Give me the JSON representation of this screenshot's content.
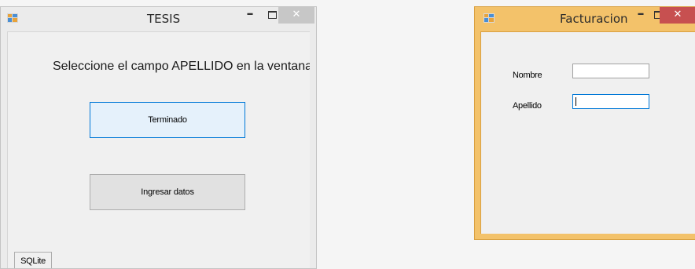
{
  "tesis_window": {
    "title": "TESIS",
    "icon": "app-form-icon",
    "minimize_glyph": "–",
    "close_glyph": "✕",
    "instruction": "Seleccione el campo APELLIDO en la ventana d",
    "buttons": {
      "terminado_label": "Terminado",
      "ingresar_label": "Ingresar datos"
    },
    "tab_label": "SQLite"
  },
  "facturacion_window": {
    "title": "Facturacion",
    "icon": "app-form-icon",
    "minimize_glyph": "–",
    "close_glyph": "✕",
    "fields": {
      "nombre_label": "Nombre",
      "nombre_value": "",
      "apellido_label": "Apellido",
      "apellido_value": ""
    }
  },
  "colors": {
    "active_frame": "#f3c26a",
    "inactive_frame": "#ebebeb",
    "focus_blue": "#0078d7",
    "close_red": "#c75050"
  }
}
